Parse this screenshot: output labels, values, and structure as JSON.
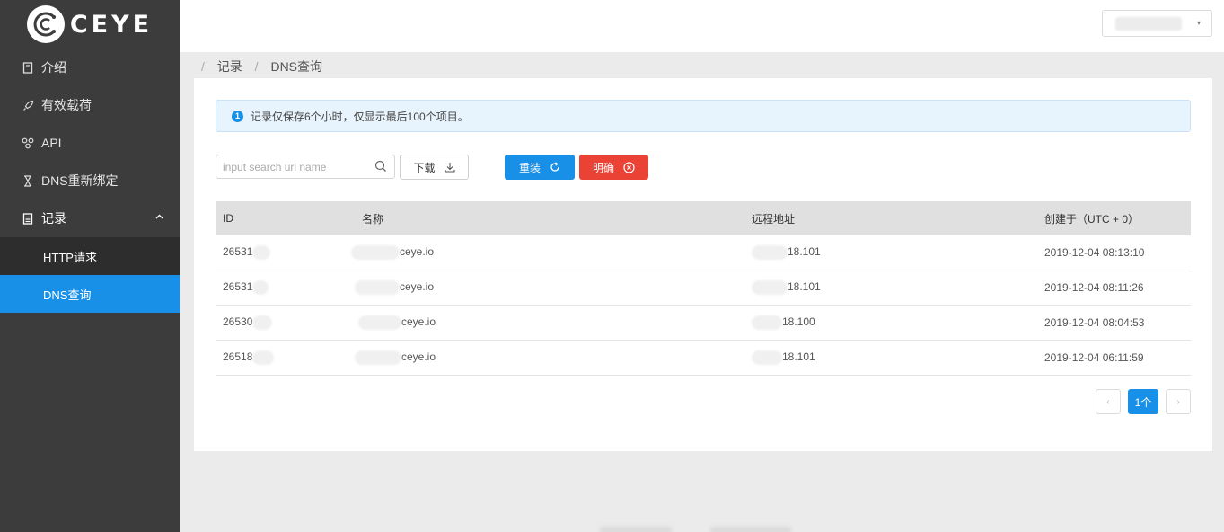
{
  "brand": {
    "name": "CEYE"
  },
  "sidebar": {
    "items": [
      {
        "label": "介绍",
        "icon": "book-icon"
      },
      {
        "label": "有效载荷",
        "icon": "rocket-icon"
      },
      {
        "label": "API",
        "icon": "api-icon"
      },
      {
        "label": "DNS重新绑定",
        "icon": "hourglass-icon"
      },
      {
        "label": "记录",
        "icon": "list-icon"
      }
    ],
    "subitems": [
      {
        "label": "HTTP请求"
      },
      {
        "label": "DNS查询"
      }
    ]
  },
  "breadcrumb": {
    "items": [
      "记录",
      "DNS查询"
    ]
  },
  "alert": {
    "text": "记录仅保存6个小时，仅显示最后100个项目。",
    "icon_text": "1"
  },
  "toolbar": {
    "search_placeholder": "input search url name",
    "download_label": "下载",
    "reload_label": "重装",
    "clear_label": "明确"
  },
  "table": {
    "headers": [
      "ID",
      "名称",
      "远程地址",
      "创建于（UTC + 0）"
    ],
    "rows": [
      {
        "id": "26531",
        "name": "ceye.io",
        "remote": "18.101",
        "created": "2019-12-04 08:13:10"
      },
      {
        "id": "26531",
        "name": "ceye.io",
        "remote": "18.101",
        "created": "2019-12-04 08:11:26"
      },
      {
        "id": "26530",
        "name": "ceye.io",
        "remote": "18.100",
        "created": "2019-12-04 08:04:53"
      },
      {
        "id": "26518",
        "name": "ceye.io",
        "remote": "18.101",
        "created": "2019-12-04 06:11:59"
      }
    ]
  },
  "pagination": {
    "prev": "‹",
    "current": "1个",
    "next": "›"
  },
  "colors": {
    "primary": "#1890e8",
    "danger": "#ea4335",
    "sidebar": "#3c3c3c"
  }
}
